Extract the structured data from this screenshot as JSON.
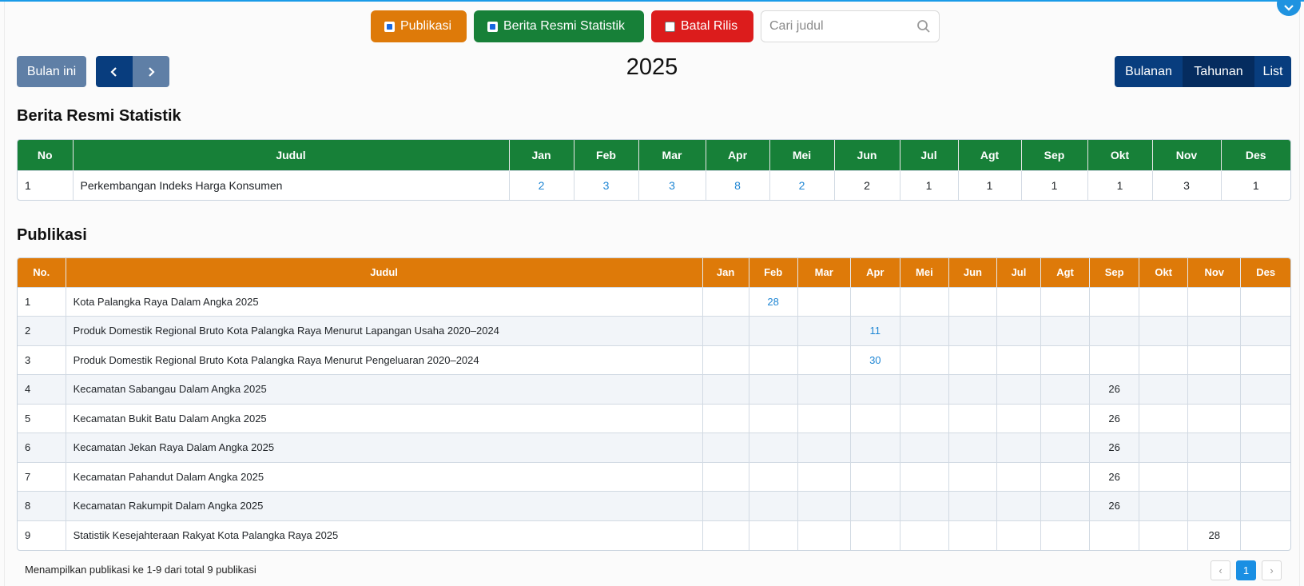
{
  "filters": {
    "publikasi": {
      "label": "Publikasi",
      "checked": true,
      "color": "#de7a09"
    },
    "brs": {
      "label": "Berita Resmi Statistik",
      "checked": true,
      "color": "#178038"
    },
    "batal": {
      "label": "Batal Rilis",
      "checked": false,
      "color": "#dc1c1c"
    },
    "search_placeholder": "Cari judul"
  },
  "nav": {
    "today_label": "Bulan ini",
    "prev_icon": "chevron-left-icon",
    "next_icon": "chevron-right-icon",
    "year": "2025",
    "views": {
      "bulanan": "Bulanan",
      "tahunan": "Tahunan",
      "list": "List"
    }
  },
  "brs_section": {
    "title": "Berita Resmi Statistik",
    "headers": [
      "No",
      "Judul",
      "Jan",
      "Feb",
      "Mar",
      "Apr",
      "Mei",
      "Jun",
      "Jul",
      "Agt",
      "Sep",
      "Okt",
      "Nov",
      "Des"
    ],
    "rows": [
      {
        "no": "1",
        "judul": "Perkembangan Indeks Harga Konsumen",
        "months": [
          "2",
          "3",
          "3",
          "8",
          "2",
          "2",
          "1",
          "1",
          "1",
          "1",
          "3",
          "1"
        ],
        "links": [
          true,
          true,
          true,
          true,
          true,
          false,
          false,
          false,
          false,
          false,
          false,
          false
        ]
      }
    ]
  },
  "pub_section": {
    "title": "Publikasi",
    "headers": [
      "No.",
      "Judul",
      "Jan",
      "Feb",
      "Mar",
      "Apr",
      "Mei",
      "Jun",
      "Jul",
      "Agt",
      "Sep",
      "Okt",
      "Nov",
      "Des"
    ],
    "rows": [
      {
        "no": "1",
        "judul": "Kota Palangka Raya Dalam Angka 2025",
        "months": [
          "",
          "28",
          "",
          "",
          "",
          "",
          "",
          "",
          "",
          "",
          "",
          ""
        ],
        "links": [
          false,
          true,
          false,
          false,
          false,
          false,
          false,
          false,
          false,
          false,
          false,
          false
        ]
      },
      {
        "no": "2",
        "judul": "Produk Domestik Regional Bruto Kota Palangka Raya Menurut Lapangan Usaha 2020–2024",
        "months": [
          "",
          "",
          "",
          "11",
          "",
          "",
          "",
          "",
          "",
          "",
          "",
          ""
        ],
        "links": [
          false,
          false,
          false,
          true,
          false,
          false,
          false,
          false,
          false,
          false,
          false,
          false
        ]
      },
      {
        "no": "3",
        "judul": "Produk Domestik Regional Bruto Kota Palangka Raya Menurut Pengeluaran 2020–2024",
        "months": [
          "",
          "",
          "",
          "30",
          "",
          "",
          "",
          "",
          "",
          "",
          "",
          ""
        ],
        "links": [
          false,
          false,
          false,
          true,
          false,
          false,
          false,
          false,
          false,
          false,
          false,
          false
        ]
      },
      {
        "no": "4",
        "judul": "Kecamatan Sabangau Dalam Angka 2025",
        "months": [
          "",
          "",
          "",
          "",
          "",
          "",
          "",
          "",
          "26",
          "",
          "",
          ""
        ],
        "links": [
          false,
          false,
          false,
          false,
          false,
          false,
          false,
          false,
          false,
          false,
          false,
          false
        ]
      },
      {
        "no": "5",
        "judul": "Kecamatan Bukit Batu Dalam Angka 2025",
        "months": [
          "",
          "",
          "",
          "",
          "",
          "",
          "",
          "",
          "26",
          "",
          "",
          ""
        ],
        "links": [
          false,
          false,
          false,
          false,
          false,
          false,
          false,
          false,
          false,
          false,
          false,
          false
        ]
      },
      {
        "no": "6",
        "judul": "Kecamatan Jekan Raya Dalam Angka 2025",
        "months": [
          "",
          "",
          "",
          "",
          "",
          "",
          "",
          "",
          "26",
          "",
          "",
          ""
        ],
        "links": [
          false,
          false,
          false,
          false,
          false,
          false,
          false,
          false,
          false,
          false,
          false,
          false
        ]
      },
      {
        "no": "7",
        "judul": "Kecamatan Pahandut Dalam Angka 2025",
        "months": [
          "",
          "",
          "",
          "",
          "",
          "",
          "",
          "",
          "26",
          "",
          "",
          ""
        ],
        "links": [
          false,
          false,
          false,
          false,
          false,
          false,
          false,
          false,
          false,
          false,
          false,
          false
        ]
      },
      {
        "no": "8",
        "judul": "Kecamatan Rakumpit Dalam Angka 2025",
        "months": [
          "",
          "",
          "",
          "",
          "",
          "",
          "",
          "",
          "26",
          "",
          "",
          ""
        ],
        "links": [
          false,
          false,
          false,
          false,
          false,
          false,
          false,
          false,
          false,
          false,
          false,
          false
        ]
      },
      {
        "no": "9",
        "judul": "Statistik Kesejahteraan Rakyat Kota Palangka Raya 2025",
        "months": [
          "",
          "",
          "",
          "",
          "",
          "",
          "",
          "",
          "",
          "",
          "28",
          ""
        ],
        "links": [
          false,
          false,
          false,
          false,
          false,
          false,
          false,
          false,
          false,
          false,
          false,
          false
        ]
      }
    ]
  },
  "footer": {
    "summary": "Menampilkan publikasi ke 1-9 dari total 9 publikasi",
    "prev": "‹",
    "current_page": "1",
    "next": "›"
  }
}
